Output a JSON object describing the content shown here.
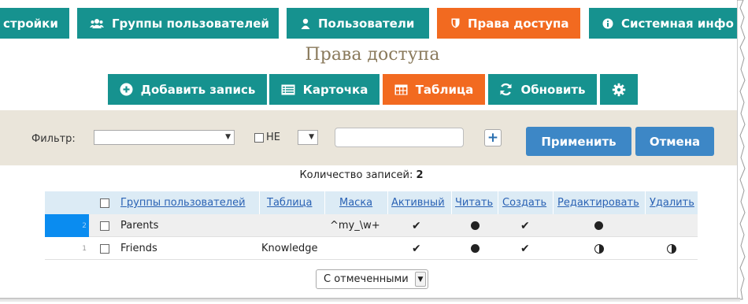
{
  "nav": {
    "tabs": [
      {
        "label": "стройки",
        "icon": "none"
      },
      {
        "label": "Группы пользователей",
        "icon": "users-icon"
      },
      {
        "label": "Пользователи",
        "icon": "user-icon"
      },
      {
        "label": "Права доступа",
        "icon": "shield-icon",
        "active": true
      },
      {
        "label": "Системная инфо",
        "icon": "info-icon"
      }
    ]
  },
  "page": {
    "title": "Права доступа"
  },
  "toolbar": {
    "add": "Добавить запись",
    "card": "Карточка",
    "table": "Таблица",
    "refresh": "Обновить",
    "settings_icon": "gear-icon"
  },
  "filter": {
    "label": "Фильтр:",
    "field_value": "",
    "not_label": "НЕ",
    "op_value": "",
    "text_value": "",
    "plus": "+",
    "apply": "Применить",
    "cancel": "Отмена"
  },
  "count": {
    "label": "Количество записей:",
    "value": "2"
  },
  "table": {
    "columns": [
      "Группы пользователей",
      "Таблица",
      "Маска",
      "Активный",
      "Читать",
      "Создать",
      "Редактировать",
      "Удалить"
    ],
    "rows": [
      {
        "num": "2",
        "group": "Parents",
        "table": "",
        "mask": "^my_\\w+",
        "active": "check",
        "read": "full",
        "create": "check",
        "edit": "full",
        "delete": "none",
        "selected": true
      },
      {
        "num": "1",
        "group": "Friends",
        "table": "Knowledge",
        "mask": "",
        "active": "check",
        "read": "full",
        "create": "check",
        "edit": "half",
        "delete": "half",
        "selected": false
      }
    ]
  },
  "bulk": {
    "label": "С отмеченными"
  },
  "colors": {
    "teal": "#16928f",
    "orange": "#f26a20",
    "blue": "#3d87c6",
    "filter_bg": "#eae5da",
    "header_bg": "#dcebf5",
    "selection": "#0a8cf0"
  }
}
